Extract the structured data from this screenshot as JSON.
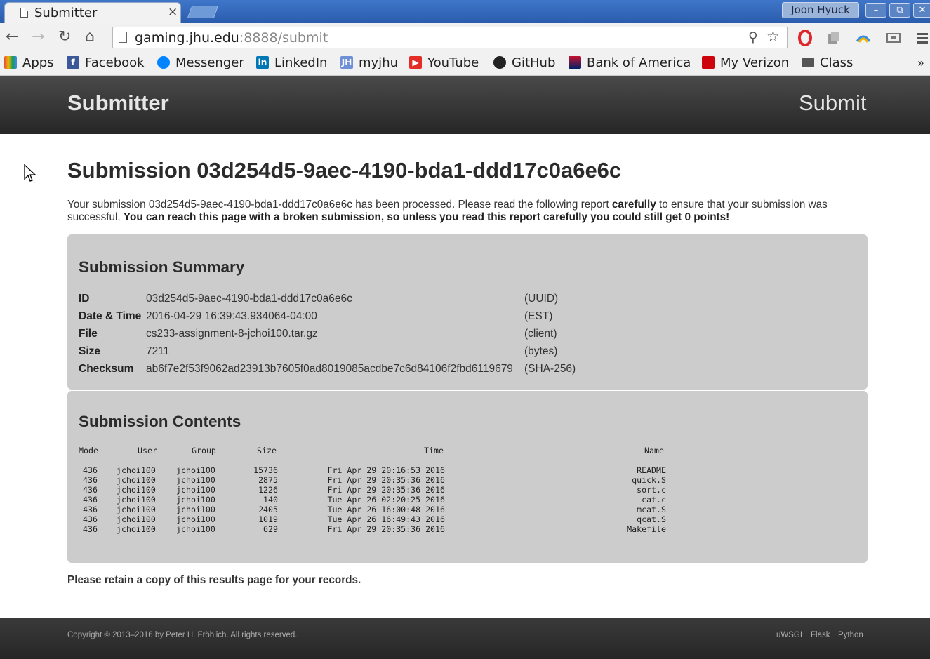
{
  "browser": {
    "tab_title": "Submitter",
    "tab_close": "×",
    "profile_name": "Joon Hyuck",
    "url_host": "gaming.jhu.edu",
    "url_rest": ":8888/submit",
    "window_buttons": [
      "–",
      "⧉",
      "✕"
    ]
  },
  "bookmarks": [
    {
      "label": "Apps",
      "icon": "apps-grid-icon",
      "color": "#e44d3a"
    },
    {
      "label": "Facebook",
      "icon": "facebook-icon",
      "color": "#3b5998"
    },
    {
      "label": "Messenger",
      "icon": "messenger-icon",
      "color": "#0084ff"
    },
    {
      "label": "LinkedIn",
      "icon": "linkedin-icon",
      "color": "#0077b5"
    },
    {
      "label": "myjhu",
      "icon": "myjhu-icon",
      "color": "#6f8fd6"
    },
    {
      "label": "YouTube",
      "icon": "youtube-icon",
      "color": "#e52d27"
    },
    {
      "label": "GitHub",
      "icon": "github-icon",
      "color": "#222222"
    },
    {
      "label": "Bank of America",
      "icon": "bank-of-america-icon",
      "color": "#c41230"
    },
    {
      "label": "My Verizon",
      "icon": "verizon-icon",
      "color": "#cd040b"
    },
    {
      "label": "Class",
      "icon": "folder-icon",
      "color": "#555555"
    }
  ],
  "site": {
    "brand": "Submitter",
    "nav_submit": "Submit"
  },
  "submission": {
    "title": "Submission 03d254d5-9aec-4190-bda1-ddd17c0a6e6c",
    "intro_1": "Your submission 03d254d5-9aec-4190-bda1-ddd17c0a6e6c has been processed. Please read the following report ",
    "intro_bold_1": "carefully",
    "intro_2": " to ensure that your submission was successful. ",
    "intro_bold_2": "You can reach this page with a broken submission, so unless you read this report carefully you could still get 0 points!"
  },
  "summary": {
    "title": "Submission Summary",
    "rows": [
      {
        "key": "ID",
        "value": "03d254d5-9aec-4190-bda1-ddd17c0a6e6c",
        "unit": "(UUID)"
      },
      {
        "key": "Date & Time",
        "value": "2016-04-29 16:39:43.934064-04:00",
        "unit": "(EST)"
      },
      {
        "key": "File",
        "value": "cs233-assignment-8-jchoi100.tar.gz",
        "unit": "(client)"
      },
      {
        "key": "Size",
        "value": "7211",
        "unit": "(bytes)"
      },
      {
        "key": "Checksum",
        "value": "ab6f7e2f53f9062ad23913b7605f0ad8019085acdbe7c6d84106f2fbd6119679",
        "unit": "(SHA-256)"
      }
    ]
  },
  "contents": {
    "title": "Submission Contents",
    "headers": {
      "mode": "Mode",
      "user": "User",
      "group": "Group",
      "size": "Size",
      "time": "Time",
      "name": "Name"
    },
    "rows": [
      {
        "mode": "436",
        "user": "jchoi100",
        "group": "jchoi100",
        "size": "15736",
        "time": "Fri Apr 29 20:16:53 2016",
        "name": "README"
      },
      {
        "mode": "436",
        "user": "jchoi100",
        "group": "jchoi100",
        "size": "2875",
        "time": "Fri Apr 29 20:35:36 2016",
        "name": "quick.S"
      },
      {
        "mode": "436",
        "user": "jchoi100",
        "group": "jchoi100",
        "size": "1226",
        "time": "Fri Apr 29 20:35:36 2016",
        "name": "sort.c"
      },
      {
        "mode": "436",
        "user": "jchoi100",
        "group": "jchoi100",
        "size": "140",
        "time": "Tue Apr 26 02:20:25 2016",
        "name": "cat.c"
      },
      {
        "mode": "436",
        "user": "jchoi100",
        "group": "jchoi100",
        "size": "2405",
        "time": "Tue Apr 26 16:00:48 2016",
        "name": "mcat.S"
      },
      {
        "mode": "436",
        "user": "jchoi100",
        "group": "jchoi100",
        "size": "1019",
        "time": "Tue Apr 26 16:49:43 2016",
        "name": "qcat.S"
      },
      {
        "mode": "436",
        "user": "jchoi100",
        "group": "jchoi100",
        "size": "629",
        "time": "Fri Apr 29 20:35:36 2016",
        "name": "Makefile"
      }
    ]
  },
  "retain_note": "Please retain a copy of this results page for your records.",
  "footer": {
    "copyright": "Copyright © 2013–2016 by Peter H. Fröhlich. All rights reserved.",
    "links": [
      "uWSGI",
      "Flask",
      "Python"
    ]
  }
}
